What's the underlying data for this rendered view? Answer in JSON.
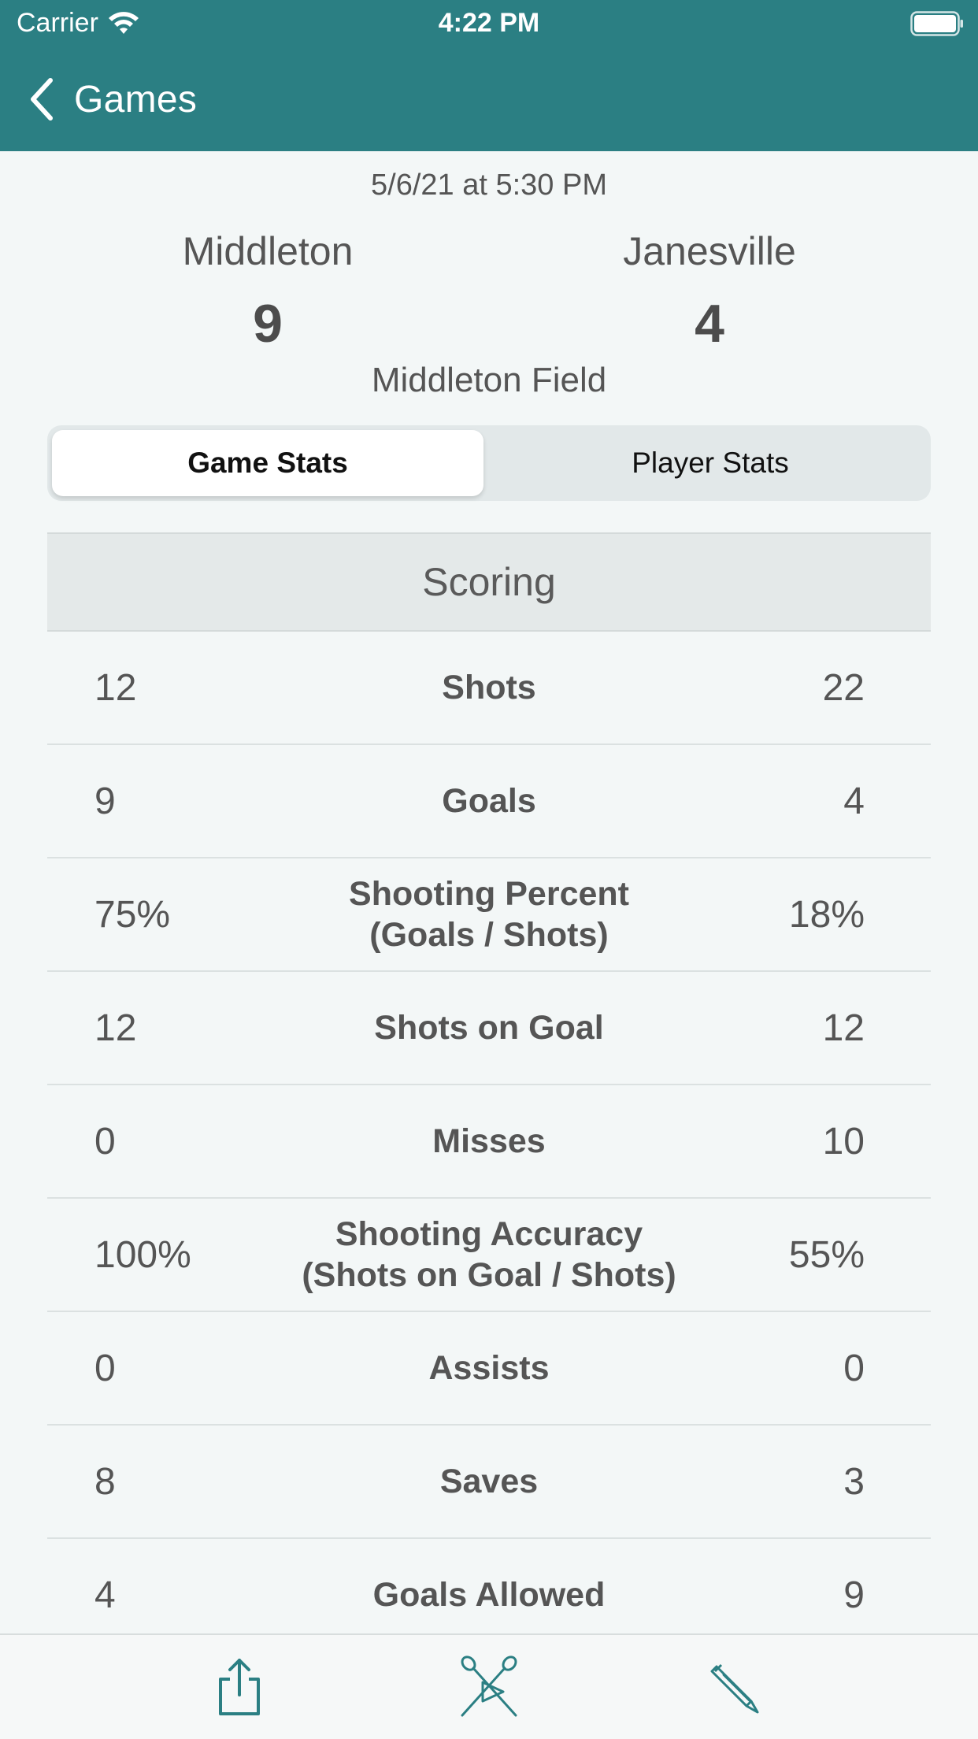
{
  "status_bar": {
    "carrier": "Carrier",
    "time": "4:22 PM"
  },
  "nav": {
    "back_label": "Games"
  },
  "game": {
    "date": "5/6/21 at 5:30 PM",
    "home_team": "Middleton",
    "away_team": "Janesville",
    "home_score": "9",
    "away_score": "4",
    "venue": "Middleton Field"
  },
  "segments": {
    "game_stats": "Game Stats",
    "player_stats": "Player Stats",
    "selected": "Game Stats"
  },
  "section": {
    "title": "Scoring"
  },
  "stats": [
    {
      "label": "Shots",
      "home": "12",
      "away": "22"
    },
    {
      "label": "Goals",
      "home": "9",
      "away": "4"
    },
    {
      "label": "Shooting Percent\n(Goals / Shots)",
      "home": "75%",
      "away": "18%"
    },
    {
      "label": "Shots on Goal",
      "home": "12",
      "away": "12"
    },
    {
      "label": "Misses",
      "home": "0",
      "away": "10"
    },
    {
      "label": "Shooting Accuracy\n(Shots on Goal / Shots)",
      "home": "100%",
      "away": "55%"
    },
    {
      "label": "Assists",
      "home": "0",
      "away": "0"
    },
    {
      "label": "Saves",
      "home": "8",
      "away": "3"
    },
    {
      "label": "Goals Allowed",
      "home": "4",
      "away": "9"
    }
  ],
  "toolbar": {
    "icons": [
      "share-icon",
      "lacrosse-play-icon",
      "pencil-icon"
    ]
  },
  "colors": {
    "accent": "#2b7f83",
    "background": "#f3f7f7",
    "section_bg": "#e4e9e9"
  }
}
